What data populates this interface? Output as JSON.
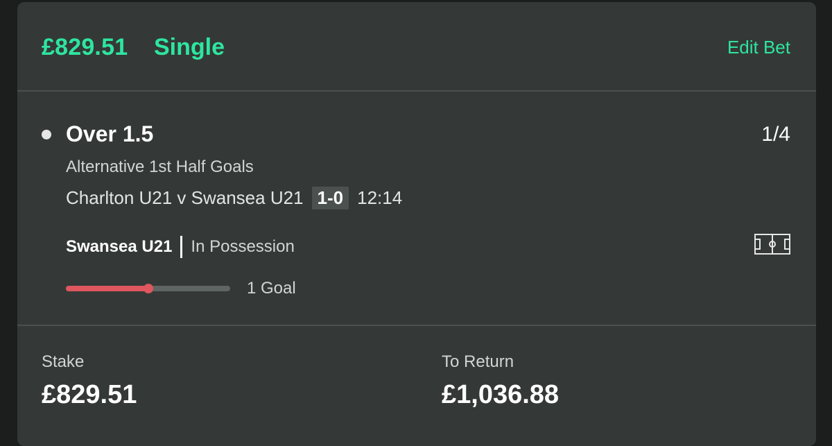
{
  "header": {
    "amount": "£829.51",
    "bet_type": "Single",
    "edit_label": "Edit Bet"
  },
  "selection": {
    "name": "Over 1.5",
    "odds": "1/4",
    "market": "Alternative 1st Half Goals",
    "event": "Charlton U21 v Swansea U21",
    "score": "1-0",
    "clock": "12:14",
    "team_in_possession": "Swansea U21",
    "possession_label": "In Possession",
    "pitch_icon": "pitch-icon",
    "progress": {
      "label": "1 Goal",
      "current_goals": 1,
      "target_goals": 2,
      "fraction": 0.5
    }
  },
  "footer": {
    "stake_label": "Stake",
    "stake_value": "£829.51",
    "return_label": "To Return",
    "return_value": "£1,036.88"
  },
  "colors": {
    "accent": "#2ee5a0",
    "card_bg": "#343937",
    "progress_fill": "#e0565e",
    "progress_track": "#5f6562"
  }
}
